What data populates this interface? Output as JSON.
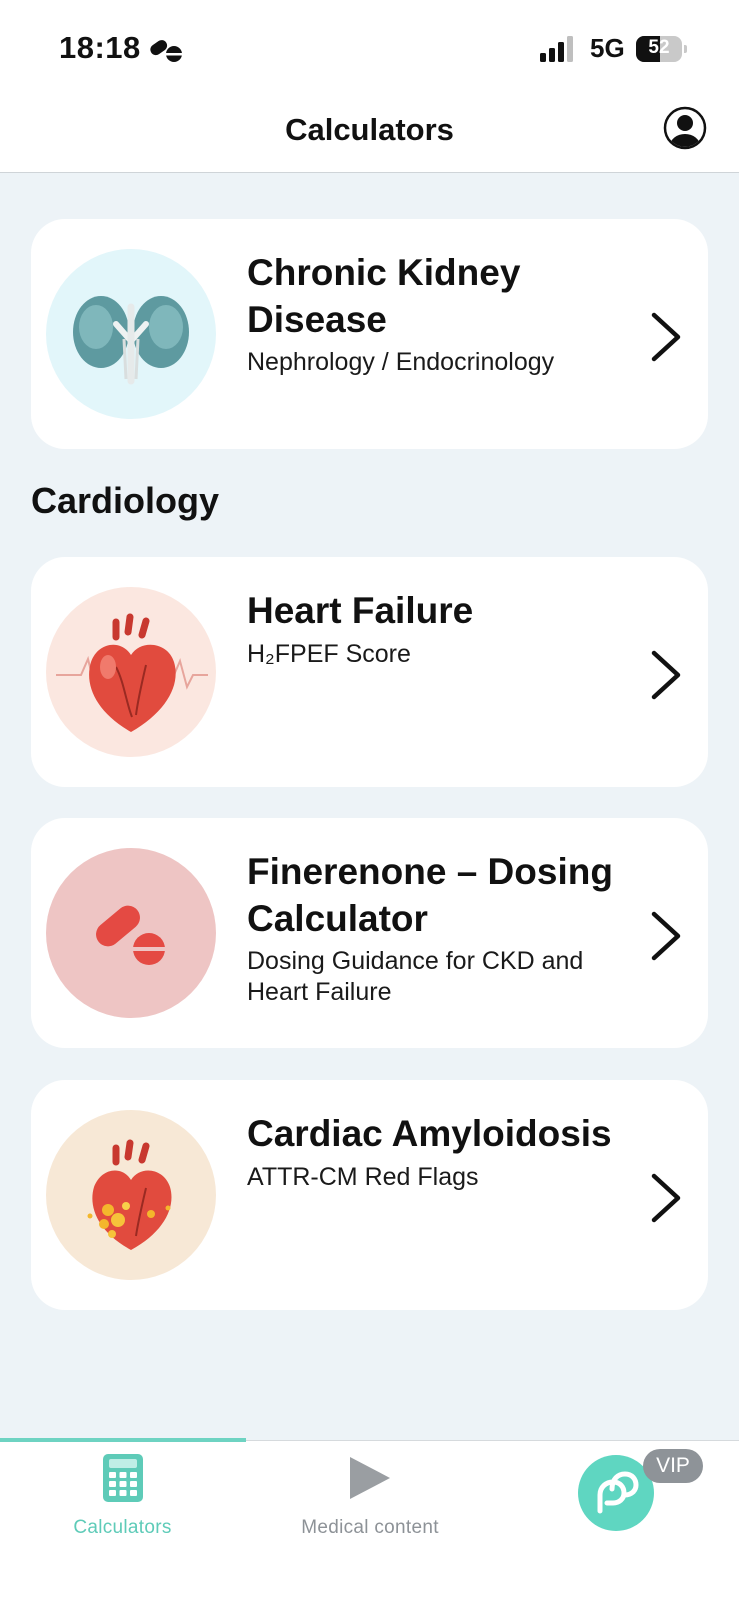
{
  "status_bar": {
    "time": "18:18",
    "network": "5G",
    "battery_level": "52",
    "battery_fraction": 0.52
  },
  "nav": {
    "title": "Calculators"
  },
  "cards": [
    {
      "title": "Chronic Kidney Disease",
      "subtitle": "Nephrology / Endocrinology",
      "image": "kidneys-illustration"
    },
    {
      "title": "Heart Failure",
      "subtitle": "H₂FPEF Score",
      "image": "heart-illustration"
    },
    {
      "title": "Finerenone – Dosing Calculator",
      "subtitle": "Dosing Guidance for CKD and Heart Failure",
      "image": "pills-illustration"
    },
    {
      "title": "Cardiac Amyloidosis",
      "subtitle": "ATTR-CM Red Flags",
      "image": "amyloid-heart-illustration"
    }
  ],
  "section": {
    "cardiology": "Cardiology"
  },
  "tab_bar": {
    "calculators_label": "Calculators",
    "medical_content_label": "Medical content",
    "vip_label": "VIP"
  },
  "colors": {
    "accent": "#5ecbb8",
    "background": "#edf3f7",
    "pill": "#e8504a"
  }
}
